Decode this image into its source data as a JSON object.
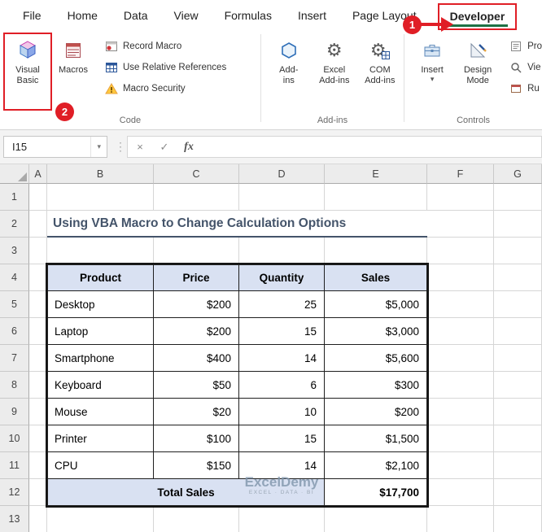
{
  "ribbon": {
    "tabs": [
      "File",
      "Home",
      "Data",
      "View",
      "Formulas",
      "Insert",
      "Page Layout",
      "Developer"
    ],
    "active_tab": "Developer",
    "code_group": {
      "label": "Code",
      "visual_basic": {
        "line1": "Visual",
        "line2": "Basic"
      },
      "macros": "Macros",
      "record_macro": "Record Macro",
      "use_relative_references": "Use Relative References",
      "macro_security": "Macro Security"
    },
    "addins_group": {
      "label": "Add-ins",
      "addins": {
        "line1": "Add-",
        "line2": "ins"
      },
      "excel_addins": {
        "line1": "Excel",
        "line2": "Add-ins"
      },
      "com_addins": {
        "line1": "COM",
        "line2": "Add-ins"
      }
    },
    "controls_group": {
      "label": "Controls",
      "insert": "Insert",
      "design_mode": {
        "line1": "Design",
        "line2": "Mode"
      },
      "properties": "Pro",
      "view_code": "Vie",
      "run_dialog": "Ru"
    }
  },
  "annotations": {
    "step1": "1",
    "step2": "2"
  },
  "formula_bar": {
    "name_box": "I15",
    "cancel": "×",
    "enter": "✓",
    "fx": "fx"
  },
  "icons": {
    "dropdown": "▾",
    "gear": "⚙",
    "dots": "⋮"
  },
  "sheet": {
    "column_headers": [
      "A",
      "B",
      "C",
      "D",
      "E",
      "F",
      "G"
    ],
    "row_headers": [
      "1",
      "2",
      "3",
      "4",
      "5",
      "6",
      "7",
      "8",
      "9",
      "10",
      "11",
      "12",
      "13"
    ],
    "title": "Using VBA Macro to Change Calculation Options",
    "table": {
      "headers": [
        "Product",
        "Price",
        "Quantity",
        "Sales"
      ],
      "rows": [
        [
          "Desktop",
          "$200",
          "25",
          "$5,000"
        ],
        [
          "Laptop",
          "$200",
          "15",
          "$3,000"
        ],
        [
          "Smartphone",
          "$400",
          "14",
          "$5,600"
        ],
        [
          "Keyboard",
          "$50",
          "6",
          "$300"
        ],
        [
          "Mouse",
          "$20",
          "10",
          "$200"
        ],
        [
          "Printer",
          "$100",
          "15",
          "$1,500"
        ],
        [
          "CPU",
          "$150",
          "14",
          "$2,100"
        ]
      ],
      "total_label": "Total Sales",
      "total_value": "$17,700"
    },
    "watermark": {
      "line1": "ExcelDemy",
      "line2": "EXCEL · DATA · BI"
    }
  },
  "colors": {
    "annotation_red": "#E01E26",
    "active_tab_green": "#1E7145",
    "table_header_fill": "#D9E1F2",
    "title_text": "#44546A"
  }
}
